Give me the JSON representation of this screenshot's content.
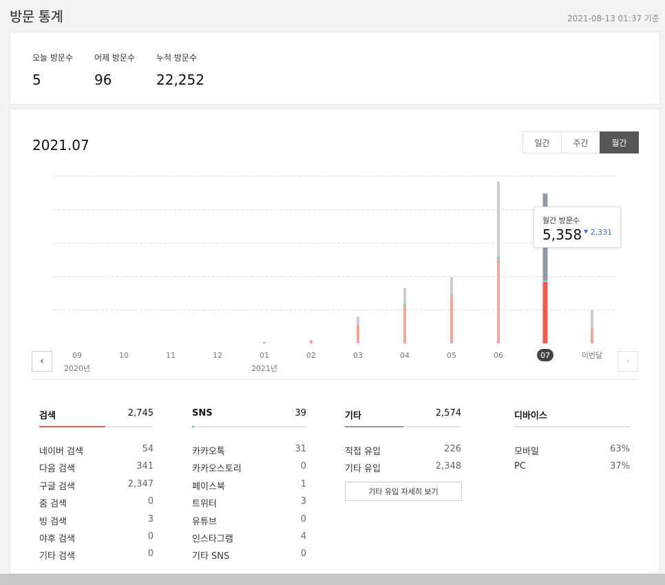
{
  "header": {
    "title": "방문 통계",
    "timestamp": "2021-08-13 01:37 기준"
  },
  "summary": [
    {
      "label": "오늘 방문수",
      "value": "5"
    },
    {
      "label": "어제 방문수",
      "value": "96"
    },
    {
      "label": "누적 방문수",
      "value": "22,252"
    }
  ],
  "chart": {
    "period": "2021.07",
    "tabs": [
      "일간",
      "주간",
      "월간"
    ],
    "active_tab": "월간",
    "tooltip": {
      "label": "월간 방문수",
      "value": "5,358",
      "delta": "2,331",
      "delta_icon": "caret-down-icon"
    },
    "next_label": "이번달"
  },
  "chart_data": {
    "type": "bar",
    "categories": [
      "09",
      "10",
      "11",
      "12",
      "01",
      "02",
      "03",
      "04",
      "05",
      "06",
      "07",
      "이번달"
    ],
    "year_labels": [
      {
        "index": 0,
        "label": "2020년"
      },
      {
        "index": 4,
        "label": "2021년"
      }
    ],
    "series": [
      {
        "color": "#f4a59e",
        "values": [
          0,
          0,
          0,
          0,
          50,
          120,
          680,
          1380,
          1720,
          3030,
          2200,
          540
        ]
      },
      {
        "color": "#6fd5c8",
        "values": [
          0,
          0,
          0,
          0,
          0,
          0,
          0,
          20,
          60,
          90,
          30,
          0
        ]
      },
      {
        "color": "#c9ced6",
        "values": [
          0,
          0,
          0,
          0,
          0,
          0,
          290,
          560,
          600,
          2690,
          3128,
          660
        ]
      }
    ],
    "selected_index": 10,
    "selected_colors": [
      "#ef5a4d",
      "#6fd5c8",
      "#909aa6"
    ],
    "ymax": 6000,
    "grid": true
  },
  "stats": {
    "search": {
      "title": "검색",
      "total": "2,745",
      "color": "#ef5a4d",
      "fill": 0.58,
      "rows": [
        {
          "label": "네이버 검색",
          "value": "54"
        },
        {
          "label": "다음 검색",
          "value": "341"
        },
        {
          "label": "구글 검색",
          "value": "2,347"
        },
        {
          "label": "줌 검색",
          "value": "0"
        },
        {
          "label": "빙 검색",
          "value": "3"
        },
        {
          "label": "야후 검색",
          "value": "0"
        },
        {
          "label": "기타 검색",
          "value": "0"
        }
      ]
    },
    "sns": {
      "title": "SNS",
      "total": "39",
      "color": "#3ec7b4",
      "fill": 0.02,
      "rows": [
        {
          "label": "카카오톡",
          "value": "31"
        },
        {
          "label": "카카오스토리",
          "value": "0"
        },
        {
          "label": "페이스북",
          "value": "1"
        },
        {
          "label": "트위터",
          "value": "3"
        },
        {
          "label": "유튜브",
          "value": "0"
        },
        {
          "label": "인스타그램",
          "value": "4"
        },
        {
          "label": "기타 SNS",
          "value": "0"
        }
      ]
    },
    "etc": {
      "title": "기타",
      "total": "2,574",
      "color": "#909aa6",
      "fill": 0.5,
      "rows": [
        {
          "label": "직접 유입",
          "value": "226"
        },
        {
          "label": "기타 유입",
          "value": "2,348"
        }
      ],
      "detail_button": "기타 유입 자세히 보기"
    },
    "device": {
      "title": "디바이스",
      "rows": [
        {
          "label": "모바일",
          "value": "63%"
        },
        {
          "label": "PC",
          "value": "37%"
        }
      ]
    }
  }
}
